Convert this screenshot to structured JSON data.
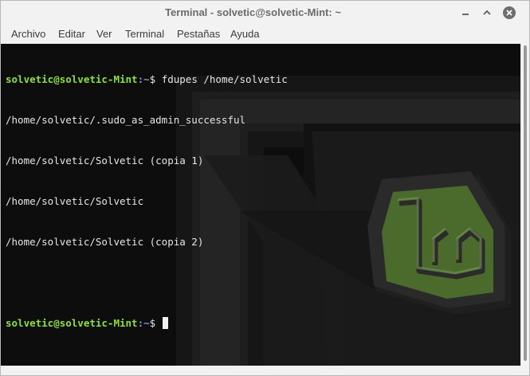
{
  "window": {
    "title": "Terminal - solvetic@solvetic-Mint: ~"
  },
  "menu": {
    "items": [
      "Archivo",
      "Editar",
      "Ver",
      "Terminal",
      "Pestañas",
      "Ayuda"
    ]
  },
  "terminal": {
    "prompt_user": "solvetic@solvetic-Mint",
    "prompt_path": ":~",
    "prompt_symbol": "$ ",
    "command": "fdupes /home/solvetic",
    "output": [
      "/home/solvetic/.sudo_as_admin_successful",
      "/home/solvetic/Solvetic (copia 1)",
      "/home/solvetic/Solvetic",
      "/home/solvetic/Solvetic (copia 2)"
    ]
  },
  "icons": {
    "minimize": "minimize-icon",
    "maximize": "maximize-icon",
    "close": "close-icon",
    "wallpaper": "linux-mint-logo"
  },
  "colors": {
    "terminal_bg": "#0d0d0d",
    "prompt_user": "#8ae234",
    "prompt_path": "#729fcf",
    "text": "#e6e6e6",
    "logo_green": "#4a6b2c"
  }
}
